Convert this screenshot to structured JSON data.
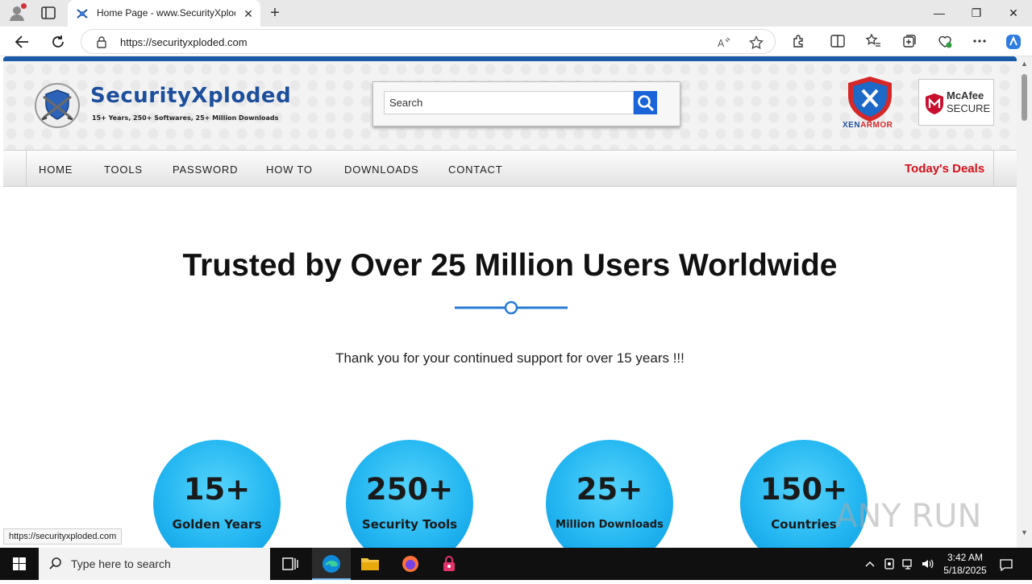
{
  "browser": {
    "tab_title": "Home Page - www.SecurityXploded.com",
    "tab_close": "✕",
    "new_tab": "+",
    "url": "https://securityxploded.com",
    "window_controls": {
      "minimize": "—",
      "restore": "❐",
      "close": "✕"
    }
  },
  "site": {
    "logo_title": "SecurityXploded",
    "logo_tagline": "15+ Years, 250+ Softwares, 25+ Million Downloads",
    "search_value": "Search",
    "partner_xen": {
      "prefix": "XEN",
      "suffix": "ARMOR"
    },
    "partner_mcafee": {
      "brand": "McAfee",
      "secure": "SECURE"
    },
    "menu": [
      "HOME",
      "TOOLS",
      "PASSWORD",
      "HOW TO",
      "DOWNLOADS",
      "CONTACT"
    ],
    "deals": "Today's Deals",
    "headline": "Trusted by Over 25 Million Users Worldwide",
    "thanks": "Thank you for your continued support for over 15 years !!!",
    "stats": [
      {
        "num": "15+",
        "label": "Golden Years"
      },
      {
        "num": "250+",
        "label": "Security Tools"
      },
      {
        "num": "25+",
        "label": "Million Downloads"
      },
      {
        "num": "150+",
        "label": "Countries"
      }
    ],
    "watermark": "ANY RUN",
    "status_url": "https://securityxploded.com"
  },
  "taskbar": {
    "search_placeholder": "Type here to search",
    "time": "3:42 AM",
    "date": "5/18/2025"
  },
  "colors": {
    "brand_blue": "#1d4f9c",
    "deals_red": "#d6101a",
    "stat_circle": "#23b6f1",
    "accent_line": "#2a7bd4"
  }
}
